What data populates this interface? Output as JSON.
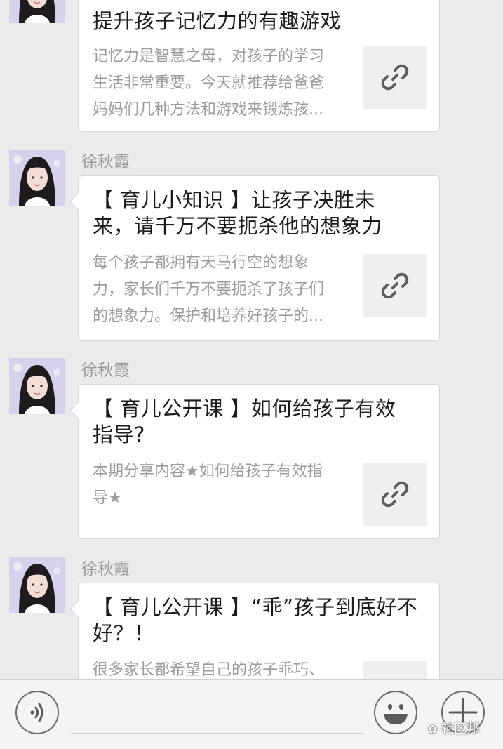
{
  "messages": [
    {
      "sender": "",
      "title": "提升孩子记忆力的有趣游戏",
      "description": [
        "记忆力是智慧之母，对孩子的学习",
        "生活非常重要。今天就推荐给爸爸",
        "妈妈们几种方法和游戏来锻炼孩..."
      ]
    },
    {
      "sender": "徐秋霞",
      "title_lines": [
        "【 育儿小知识 】让孩子决胜未",
        "来，请千万不要扼杀他的想象力"
      ],
      "description": [
        "每个孩子都拥有天马行空的想象",
        "力，家长们千万不要扼杀了孩子们",
        "的想象力。保护和培养好孩子的..."
      ]
    },
    {
      "sender": "徐秋霞",
      "title_lines": [
        "【 育儿公开课 】如何给孩子有效",
        "指导?"
      ],
      "description": [
        "本期分享内容★如何给孩子有效指",
        "导★"
      ]
    },
    {
      "sender": "徐秋霞",
      "title_lines": [
        "【 育儿公开课 】“乖”孩子到底好不",
        "好？！"
      ],
      "description": [
        "很多家长都希望自己的孩子乖巧、"
      ]
    }
  ],
  "bottom_bar": {
    "watermark": "社区邦",
    "icons": [
      "voice-icon",
      "emoji-icon",
      "plus-icon"
    ]
  },
  "colors": {
    "background": "#ebebeb",
    "card": "#ffffff",
    "sender": "#9a9a9a",
    "description": "#9c9c9c",
    "title": "#1a1a1a"
  }
}
